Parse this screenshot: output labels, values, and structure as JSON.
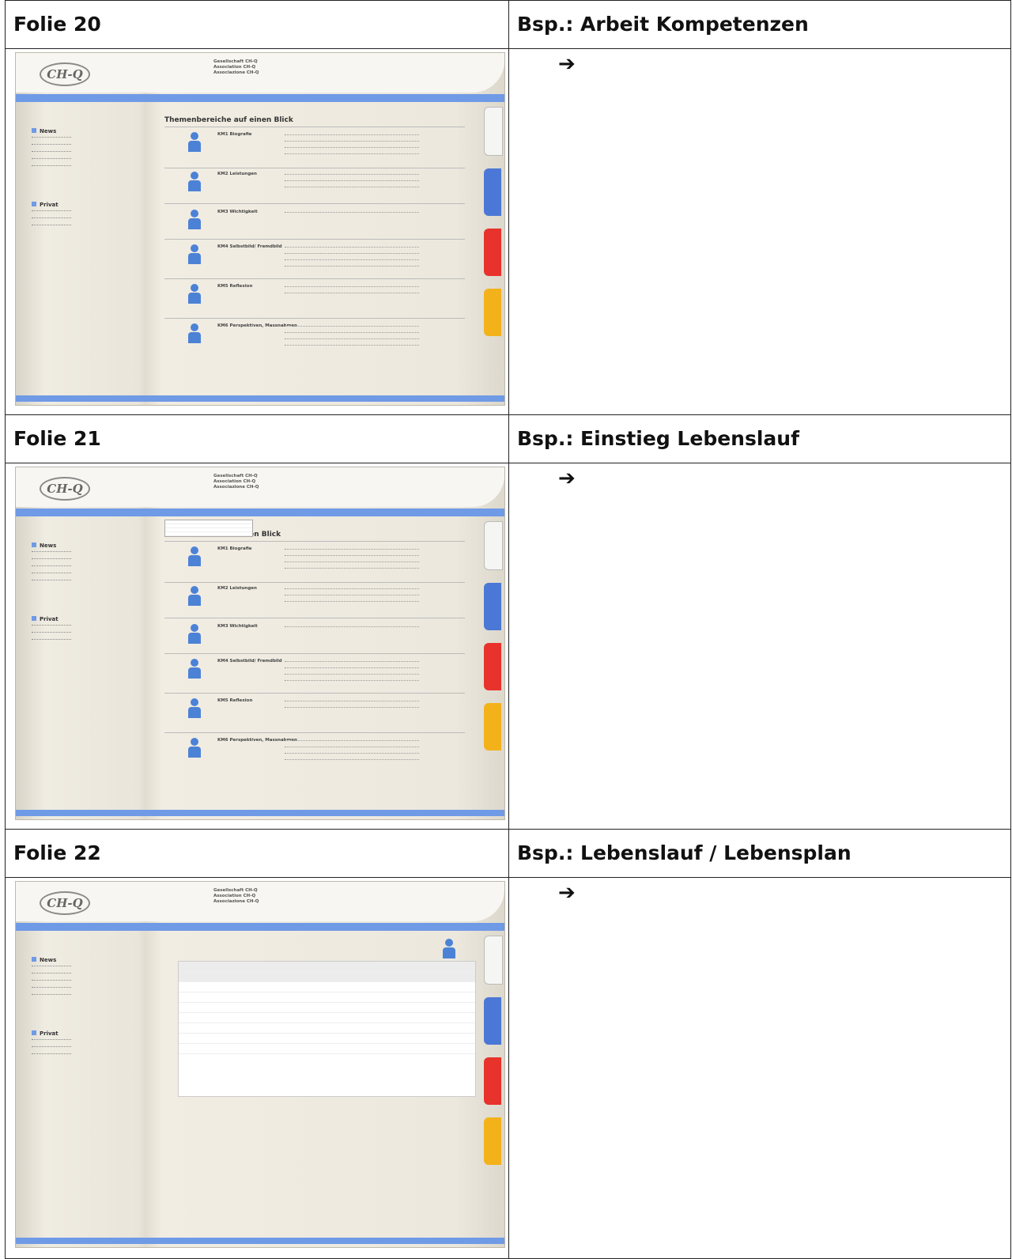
{
  "slides": [
    {
      "label": "Folie 20",
      "caption": "Bsp.: Arbeit Kompetenzen",
      "arrow": "➔",
      "shot": {
        "logo": "CH-Q",
        "view_title": "Themenbereiche auf einen Blick"
      }
    },
    {
      "label": "Folie 21",
      "caption": "Bsp.: Einstieg Lebenslauf",
      "arrow": "➔",
      "shot": {
        "logo": "CH-Q",
        "view_title": "auf einen Blick"
      }
    },
    {
      "label": "Folie 22",
      "caption": "Bsp.: Lebenslauf / Lebensplan",
      "arrow": "➔",
      "shot": {
        "logo": "CH-Q"
      }
    }
  ],
  "screen": {
    "orgs": [
      "Gesellschaft CH-Q",
      "Association CH-Q",
      "Associazione CH-Q"
    ],
    "left": {
      "news": "News",
      "private": "Privat"
    },
    "km_rows": [
      "KM1 Biografie",
      "KM2 Leistungen",
      "KM3 Wichtigkeit",
      "KM4 Selbstbild/ Fremdbild",
      "KM5 Reflexion",
      "KM6 Perspektiven, Massnahmen"
    ]
  }
}
